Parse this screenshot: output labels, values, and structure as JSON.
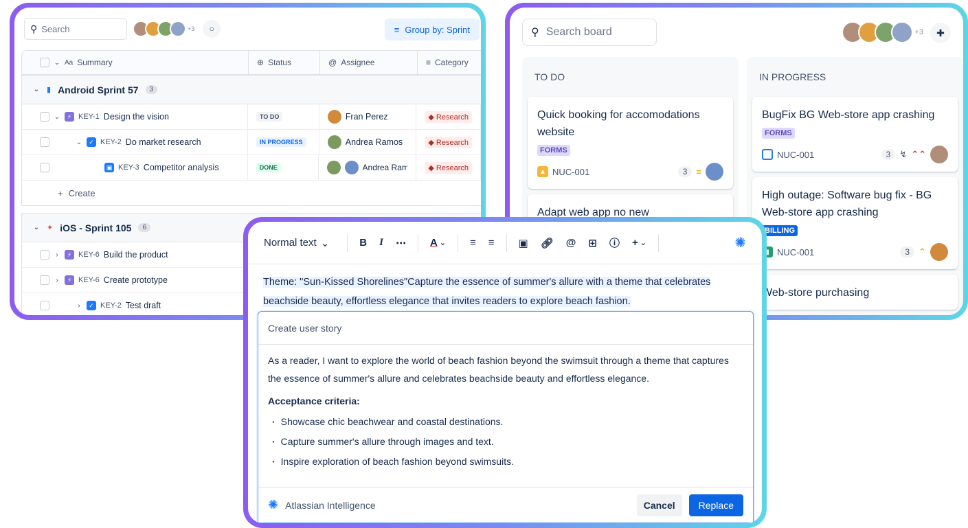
{
  "list": {
    "search_placeholder": "Search",
    "avatar_count": "+3",
    "group_by": "Group by: Sprint",
    "headers": {
      "summary": "Summary",
      "status": "Status",
      "assignee": "Assignee",
      "category": "Category"
    },
    "groups": [
      {
        "name": "Android Sprint 57",
        "count": "3",
        "rows": [
          {
            "key": "KEY-1",
            "title": "Design the vision",
            "status": "TO DO",
            "assignee": "Fran Perez",
            "category": "Research"
          },
          {
            "key": "KEY-2",
            "title": "Do market research",
            "status": "IN PROGRESS",
            "assignee": "Andrea Ramos",
            "category": "Research"
          },
          {
            "key": "KEY-3",
            "title": "Competitor analysis",
            "status": "DONE",
            "assignee": "Andrea Ram",
            "category": "Research"
          }
        ],
        "create": "Create"
      },
      {
        "name": "iOS - Sprint 105",
        "count": "6",
        "rows": [
          {
            "key": "KEY-6",
            "title": "Build the product"
          },
          {
            "key": "KEY-6",
            "title": "Create prototype"
          },
          {
            "key": "KEY-2",
            "title": "Test draft"
          }
        ]
      }
    ]
  },
  "board": {
    "search_placeholder": "Search board",
    "avatar_count": "+3",
    "columns": [
      {
        "title": "TO DO",
        "cards": [
          {
            "title": "Quick booking for accomodations website",
            "label": "FORMS",
            "key": "NUC-001",
            "count": "3"
          },
          {
            "title": "Adapt web app no new"
          }
        ]
      },
      {
        "title": "IN PROGRESS",
        "cards": [
          {
            "title": "BugFix BG Web-store app crashing",
            "label": "FORMS",
            "key": "NUC-001",
            "count": "3"
          },
          {
            "title": "High outage: Software bug fix - BG Web-store app crashing",
            "label": "BILLING",
            "key": "NUC-001",
            "count": "3"
          },
          {
            "title": "Web-store purchasing"
          }
        ]
      }
    ]
  },
  "editor": {
    "text_style": "Normal text",
    "selected_text": "Theme:  \"Sun-Kissed Shorelines\"Capture the essence of summer's allure with a theme that celebrates beachside beauty, effortless elegance that invites readers to explore  beach fashion.",
    "ai": {
      "prompt": "Create user story",
      "story": "As a reader, I want to explore the world of beach fashion beyond the swimsuit through a theme that captures the essence of summer's allure and celebrates beachside beauty and effortless elegance.",
      "criteria_heading": "Acceptance criteria:",
      "criteria": [
        "Showcase chic beachwear and coastal destinations.",
        "Capture summer's allure through images and text.",
        "Inspire exploration of beach fashion beyond swimsuits."
      ],
      "brand": "Atlassian Intelligence",
      "cancel": "Cancel",
      "replace": "Replace"
    }
  }
}
